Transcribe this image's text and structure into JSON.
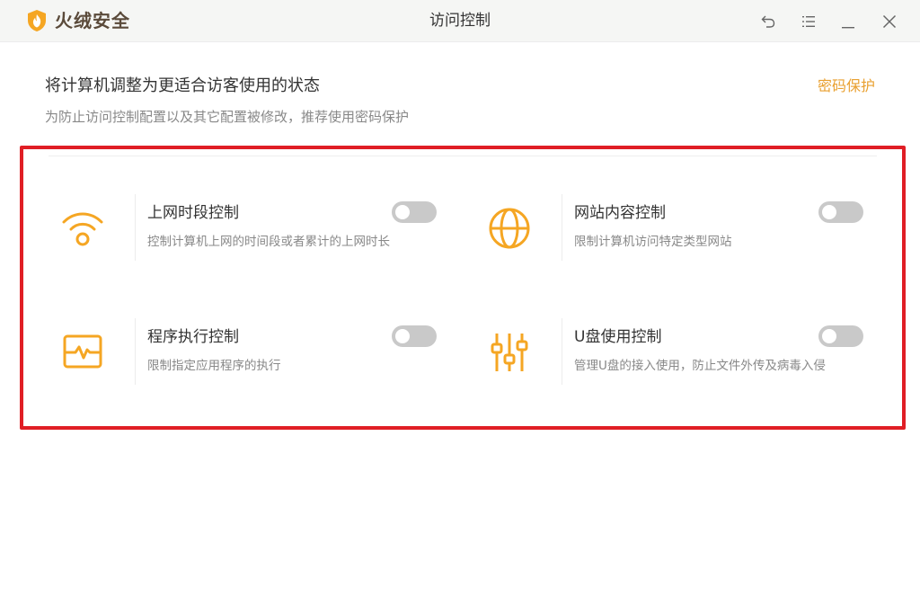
{
  "app": {
    "name": "火绒安全",
    "window_title": "访问控制"
  },
  "header": {
    "heading": "将计算机调整为更适合访客使用的状态",
    "subheading": "为防止访问控制配置以及其它配置被修改，推荐使用密码保护",
    "password_link": "密码保护"
  },
  "colors": {
    "accent": "#f5a623",
    "link": "#e9a030",
    "highlight_border": "#e01e25",
    "toggle_off": "#c9c9c9"
  },
  "controls": [
    {
      "title": "上网时段控制",
      "desc": "控制计算机上网的时间段或者累计的上网时长",
      "icon": "wifi-icon",
      "enabled": false
    },
    {
      "title": "网站内容控制",
      "desc": "限制计算机访问特定类型网站",
      "icon": "globe-icon",
      "enabled": false
    },
    {
      "title": "程序执行控制",
      "desc": "限制指定应用程序的执行",
      "icon": "program-monitor-icon",
      "enabled": false
    },
    {
      "title": "U盘使用控制",
      "desc": "管理U盘的接入使用，防止文件外传及病毒入侵",
      "icon": "sliders-icon",
      "enabled": false
    }
  ]
}
